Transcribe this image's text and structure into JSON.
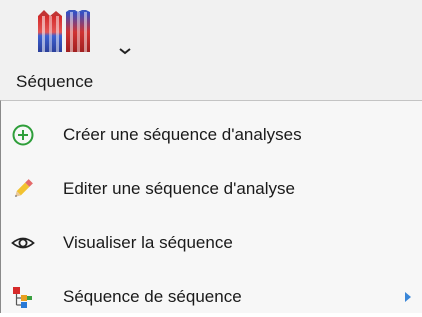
{
  "ribbon": {
    "sequence_button": {
      "label": "Séquence",
      "icon": "sequence-icon",
      "dropdown_icon": "chevron-down-icon"
    }
  },
  "menu": {
    "items": [
      {
        "label": "Créer une séquence d'analyses",
        "icon": "add-circle-icon"
      },
      {
        "label": "Editer une séquence d'analyse",
        "icon": "pencil-icon"
      },
      {
        "label": "Visualiser la séquence",
        "icon": "eye-icon"
      },
      {
        "label": "Séquence de séquence",
        "icon": "nested-sequence-icon",
        "submenu_icon": "submenu-arrow-icon"
      }
    ]
  },
  "colors": {
    "ribbon_bg": "#f1f1f1",
    "menu_bg": "#f7f7f7",
    "add_icon_green": "#2e9e3a",
    "pencil_yellow": "#f2c230",
    "submenu_arrow_blue": "#3a86d8"
  }
}
